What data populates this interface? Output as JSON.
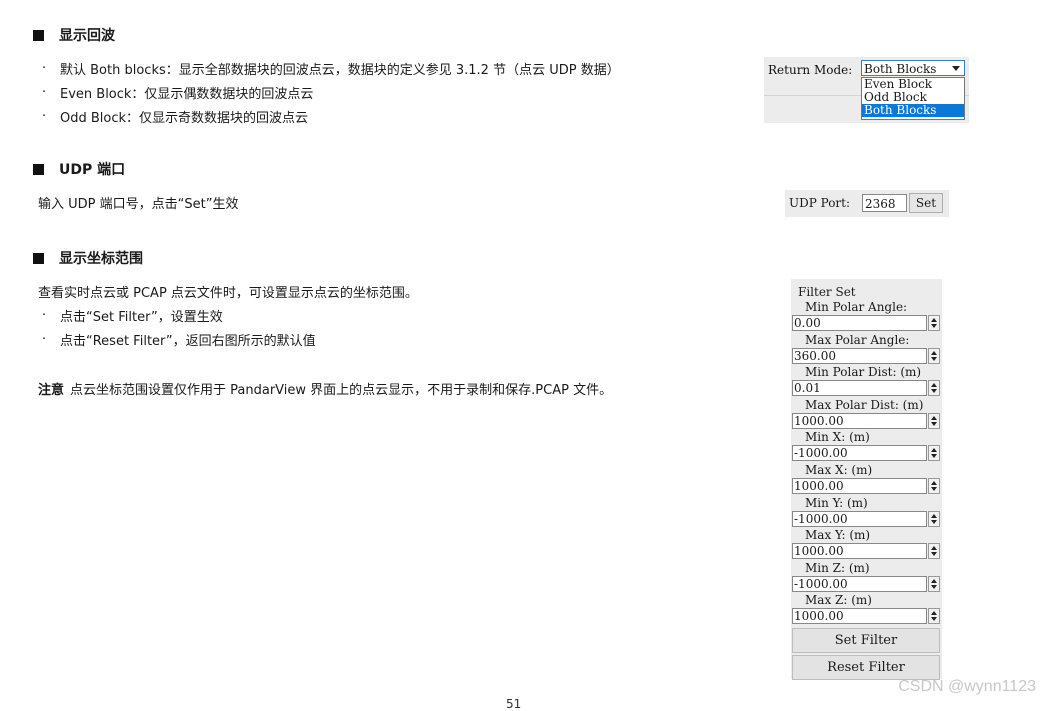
{
  "sections": {
    "display_return": {
      "heading": "显示回波",
      "bullets": [
        "默认 Both blocks：显示全部数据块的回波点云，数据块的定义参见 3.1.2 节（点云 UDP 数据）",
        "Even Block：仅显示偶数数据块的回波点云",
        "Odd Block：仅显示奇数数据块的回波点云"
      ]
    },
    "udp_port": {
      "heading": "UDP 端口",
      "text": "输入 UDP 端口号，点击“Set”生效"
    },
    "coord_range": {
      "heading": "显示坐标范围",
      "text": "查看实时点云或 PCAP 点云文件时，可设置显示点云的坐标范围。",
      "bullets": [
        "点击“Set Filter”，设置生效",
        "点击“Reset Filter”，返回右图所示的默认值"
      ],
      "note_label": "注意",
      "note_text": "点云坐标范围设置仅作用于 PandarView 界面上的点云显示，不用于录制和保存.PCAP 文件。"
    }
  },
  "bullet_char": "·",
  "return_mode": {
    "label": "Return Mode:",
    "selected": "Both Blocks",
    "options": [
      "Even Block",
      "Odd Block",
      "Both Blocks"
    ]
  },
  "udp": {
    "label": "UDP Port:",
    "value": "2368",
    "button": "Set"
  },
  "filter": {
    "title": "Filter Set",
    "fields": [
      {
        "label": "Min Polar Angle:",
        "value": "0.00"
      },
      {
        "label": "Max Polar Angle:",
        "value": "360.00"
      },
      {
        "label": "Min Polar Dist: (m)",
        "value": "0.01"
      },
      {
        "label": "Max Polar Dist: (m)",
        "value": "1000.00"
      },
      {
        "label": "Min X: (m)",
        "value": "-1000.00"
      },
      {
        "label": "Max X: (m)",
        "value": "1000.00"
      },
      {
        "label": "Min Y: (m)",
        "value": "-1000.00"
      },
      {
        "label": "Max Y: (m)",
        "value": "1000.00"
      },
      {
        "label": "Min Z: (m)",
        "value": "-1000.00"
      },
      {
        "label": "Max Z: (m)",
        "value": "1000.00"
      }
    ],
    "set_button": "Set Filter",
    "reset_button": "Reset Filter"
  },
  "watermark": "CSDN @wynn1123",
  "page_number": "51"
}
